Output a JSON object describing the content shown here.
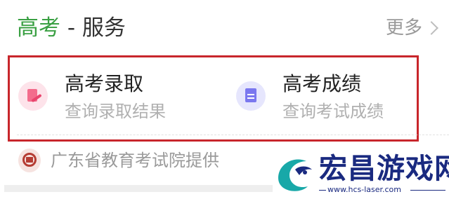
{
  "header": {
    "title_accent": "高考",
    "title_rest": " - 服务",
    "more_label": "更多"
  },
  "services": [
    {
      "name": "高考录取",
      "desc": "查询录取结果",
      "icon": "pen-document-icon",
      "icon_color": "#f36c8c"
    },
    {
      "name": "高考成绩",
      "desc": "查询考试成绩",
      "icon": "score-document-icon",
      "icon_color": "#7a77ef"
    }
  ],
  "provider": {
    "label": "广东省教育考试院提供",
    "logo_icon": "exam-institute-logo-icon"
  },
  "watermark": {
    "brand": "宏昌游戏网",
    "url": "www.hcs-laser.com"
  },
  "colors": {
    "accent_green": "#3aa043",
    "highlight_border": "#c8262b",
    "watermark_blue": "#1a2a80",
    "watermark_teal": "#18a8a8"
  }
}
